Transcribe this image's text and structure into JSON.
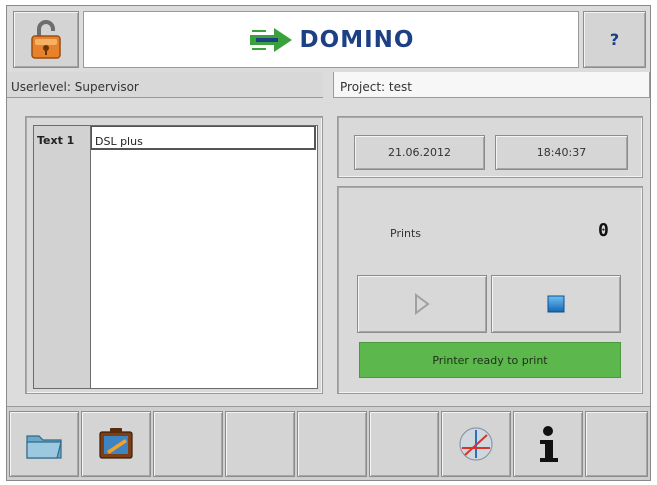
{
  "header": {
    "brand": "DOMINO",
    "help_label": "?",
    "lock_icon": "padlock-unlocked-icon",
    "logo_icon": "domino-arrow-logo-icon",
    "brand_color": "#1d3f84",
    "logo_color": "#3aa13c"
  },
  "status": {
    "userlevel": "Userlevel: Supervisor",
    "project": "Project: test"
  },
  "texts": {
    "row_label": "Text 1",
    "row_value": "DSL plus"
  },
  "info": {
    "date": "21.06.2012",
    "time": "18:40:37",
    "prints_label": "Prints",
    "prints_value": "0",
    "play_icon": "play-icon",
    "stop_icon": "stop-icon",
    "status_message": "Printer ready to print",
    "status_color": "#5cb84c",
    "stop_color": "#1e7fd0"
  },
  "toolbar": {
    "folder_icon": "folder-icon",
    "editor_icon": "layout-editor-icon",
    "calibration_icon": "axis-calibration-icon",
    "info_icon": "info-icon"
  }
}
